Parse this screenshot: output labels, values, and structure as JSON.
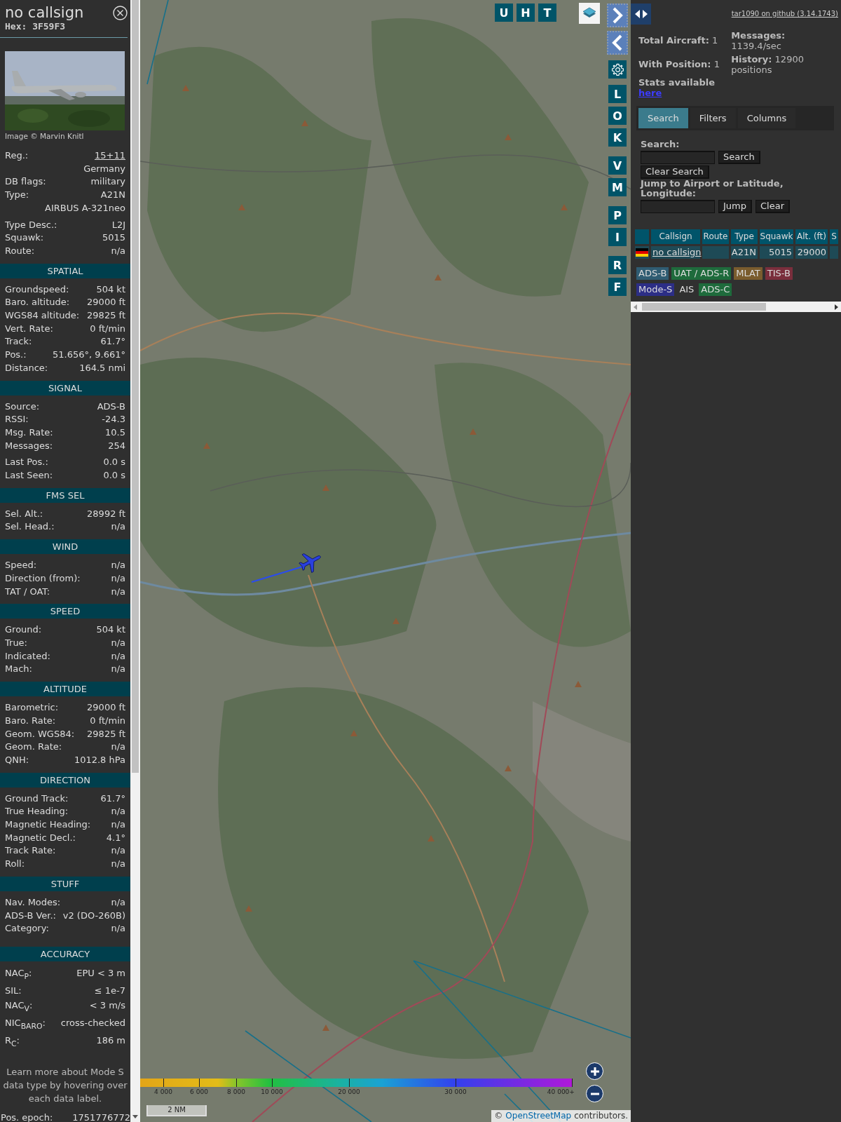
{
  "sidebar": {
    "title": "no callsign",
    "hex": "Hex: 3F59F3",
    "photo_credit": "Image © Marvin Knitl",
    "info_groups": [
      [
        {
          "kind": "link",
          "label": "Reg.:",
          "value": "15+11"
        },
        {
          "kind": "value_only",
          "value": "Germany"
        },
        {
          "kind": "pair",
          "label": "DB flags:",
          "value": "military"
        },
        {
          "kind": "pair",
          "label": "Type:",
          "value": "A21N"
        },
        {
          "kind": "value_only",
          "value": "AIRBUS A-321neo"
        }
      ],
      [
        {
          "kind": "pair",
          "label": "Type Desc.:",
          "value": "L2J"
        },
        {
          "kind": "pair",
          "label": "Squawk:",
          "value": "5015"
        },
        {
          "kind": "pair",
          "label": "Route:",
          "value": "n/a"
        }
      ]
    ],
    "sections": [
      {
        "title": "SPATIAL",
        "groups": [
          [
            {
              "label": "Groundspeed:",
              "value": "504 kt"
            },
            {
              "label": "Baro. altitude:",
              "value": "29000 ft"
            },
            {
              "label": "WGS84 altitude:",
              "value": "29825 ft"
            },
            {
              "label": "Vert. Rate:",
              "value": "0 ft/min"
            },
            {
              "label": "Track:",
              "value": "61.7°"
            },
            {
              "label": "Pos.:",
              "value": "51.656°, 9.661°"
            },
            {
              "label": "Distance:",
              "value": "164.5 nmi"
            }
          ]
        ]
      },
      {
        "title": "SIGNAL",
        "groups": [
          [
            {
              "label": "Source:",
              "value": "ADS-B"
            },
            {
              "label": "RSSI:",
              "value": "-24.3"
            },
            {
              "label": "Msg. Rate:",
              "value": "10.5"
            },
            {
              "label": "Messages:",
              "value": "254"
            }
          ],
          [
            {
              "label": "Last Pos.:",
              "value": "0.0 s"
            },
            {
              "label": "Last Seen:",
              "value": "0.0 s"
            }
          ]
        ]
      },
      {
        "title": "FMS SEL",
        "groups": [
          [
            {
              "label": "Sel. Alt.:",
              "value": "28992 ft"
            },
            {
              "label": "Sel. Head.:",
              "value": "n/a"
            }
          ]
        ]
      },
      {
        "title": "WIND",
        "groups": [
          [
            {
              "label": "Speed:",
              "value": "n/a"
            },
            {
              "label": "Direction (from):",
              "value": "n/a"
            },
            {
              "label": "TAT / OAT:",
              "value": "n/a"
            }
          ]
        ]
      },
      {
        "title": "SPEED",
        "groups": [
          [
            {
              "label": "Ground:",
              "value": "504 kt"
            },
            {
              "label": "True:",
              "value": "n/a"
            },
            {
              "label": "Indicated:",
              "value": "n/a"
            },
            {
              "label": "Mach:",
              "value": "n/a"
            }
          ]
        ]
      },
      {
        "title": "ALTITUDE",
        "groups": [
          [
            {
              "label": "Barometric:",
              "value": "29000 ft"
            },
            {
              "label": "Baro. Rate:",
              "value": "0 ft/min"
            },
            {
              "label": "Geom. WGS84:",
              "value": "29825 ft"
            },
            {
              "label": "Geom. Rate:",
              "value": "n/a"
            },
            {
              "label": "QNH:",
              "value": "1012.8 hPa"
            }
          ]
        ]
      },
      {
        "title": "DIRECTION",
        "groups": [
          [
            {
              "label": "Ground Track:",
              "value": "61.7°"
            },
            {
              "label": "True Heading:",
              "value": "n/a"
            },
            {
              "label": "Magnetic Heading:",
              "value": "n/a"
            },
            {
              "label": "Magnetic Decl.:",
              "value": "4.1°"
            },
            {
              "label": "Track Rate:",
              "value": "n/a"
            },
            {
              "label": "Roll:",
              "value": "n/a"
            }
          ]
        ]
      },
      {
        "title": "STUFF",
        "groups": [
          [
            {
              "label": "Nav. Modes:",
              "value": "n/a"
            },
            {
              "label": "ADS-B Ver.:",
              "value": "v2 (DO-260B)"
            },
            {
              "label": "Category:",
              "value": "n/a"
            }
          ]
        ]
      },
      {
        "title": "ACCURACY",
        "groups": [
          [
            {
              "label": "NAC$_{P}$:",
              "value": "EPU < 3 m"
            },
            {
              "label": "SIL:",
              "value": "≤ 1e-7"
            },
            {
              "label": "NAC$_{V}$:",
              "value": "< 3 m/s"
            },
            {
              "label": "NIC$_{BARO}$:",
              "value": "cross-checked"
            },
            {
              "label": "R$_{C}$:",
              "value": "186 m"
            }
          ]
        ]
      }
    ],
    "note": "Learn more about Mode S data type by hovering over each data label.",
    "footer_row": {
      "label": "Pos. epoch:",
      "value": "1751776772"
    }
  },
  "map": {
    "top_buttons": [
      "U",
      "H",
      "T"
    ],
    "side_button_groups": [
      [
        "L",
        "O",
        "K"
      ],
      [
        "V",
        "M"
      ],
      [
        "P",
        "I"
      ],
      [
        "R",
        "F"
      ]
    ],
    "altitude_legend": [
      "4 000",
      "6 000",
      "8 000",
      "10 000",
      "20 000",
      "30 000",
      "40 000+"
    ],
    "scale": "2 NM",
    "attribution": {
      "prefix": "©",
      "link": "OpenStreetMap",
      "suffix": "contributors."
    }
  },
  "panel": {
    "github_link": "tar1090 on github (3.14.1743)",
    "stats": {
      "total_aircraft": {
        "label": "Total Aircraft:",
        "value": "1"
      },
      "with_position": {
        "label": "With Position:",
        "value": "1"
      },
      "stats_available": {
        "label": "Stats available",
        "link": "here"
      },
      "messages": {
        "label": "Messages:",
        "value": "1139.4/sec"
      },
      "history": {
        "label": "History:",
        "value": "12900 positions"
      }
    },
    "tabs": [
      {
        "label": "Search",
        "selected": true
      },
      {
        "label": "Filters",
        "selected": false
      },
      {
        "label": "Columns",
        "selected": false
      }
    ],
    "search": {
      "label": "Search:",
      "button": "Search",
      "clear_button": "Clear Search"
    },
    "jump": {
      "label": "Jump to Airport or Latitude, Longitude:",
      "button": "Jump",
      "clear_button": "Clear"
    },
    "table": {
      "columns": [
        "Callsign",
        "Route",
        "Type",
        "Squawk",
        "Alt. (ft)",
        "S"
      ],
      "rows": [
        {
          "callsign": "no callsign",
          "type": "A21N",
          "squawk": "5015",
          "altitude": "29000"
        }
      ]
    },
    "source_tags": [
      {
        "label": "ADS-B",
        "color": "#2f5c72"
      },
      {
        "label": "UAT / ADS-R",
        "color": "#1e6b3c"
      },
      {
        "label": "MLAT",
        "color": "#7a5c2e"
      },
      {
        "label": "TIS-B",
        "color": "#7a2e3c"
      },
      {
        "label": "Mode-S",
        "color": "#2c2e86"
      },
      {
        "label": "AIS"
      },
      {
        "label": "ADS-C",
        "color": "#1e6b3c"
      }
    ]
  }
}
